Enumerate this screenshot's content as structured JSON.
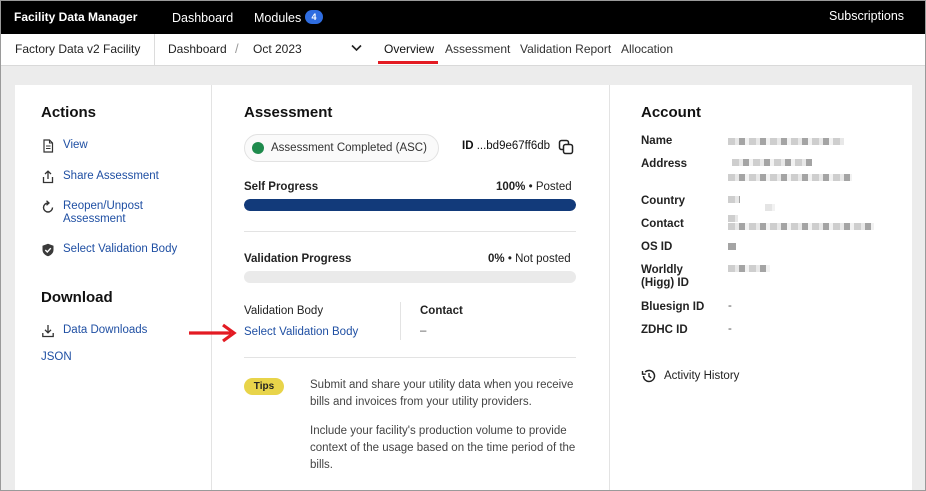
{
  "topbar": {
    "brand": "Facility Data Manager",
    "dashboard": "Dashboard",
    "modules": "Modules",
    "modules_count": "4",
    "subscriptions": "Subscriptions"
  },
  "subnav": {
    "facility": "Factory Data v2 Facility",
    "breadcrumb": "Dashboard",
    "separator": "/",
    "period": "Oct 2023",
    "tabs": [
      "Overview",
      "Assessment",
      "Validation Report",
      "Allocation"
    ],
    "active_tab": "Overview"
  },
  "actions": {
    "title": "Actions",
    "items": [
      {
        "label": "View",
        "icon": "document-icon"
      },
      {
        "label": "Share Assessment",
        "icon": "share-icon"
      },
      {
        "label": "Reopen/Unpost Assessment",
        "icon": "refresh-icon"
      },
      {
        "label": "Select Validation Body",
        "icon": "shield-check-icon"
      }
    ]
  },
  "download": {
    "title": "Download",
    "items": [
      {
        "label": "Data Downloads",
        "icon": "download-icon"
      },
      {
        "label": "JSON"
      }
    ]
  },
  "assessment": {
    "title": "Assessment",
    "status": "Assessment Completed (ASC)",
    "id_label": "ID",
    "id_value": "...bd9e67ff6db",
    "self_progress": {
      "label": "Self Progress",
      "percent": "100%",
      "sep": "•",
      "state": "Posted",
      "fraction": 1.0
    },
    "validation_progress": {
      "label": "Validation Progress",
      "percent": "0%",
      "sep": "•",
      "state": "Not posted",
      "fraction": 0.0
    },
    "validation_body_label": "Validation Body",
    "validation_body_link": "Select Validation Body",
    "contact_label": "Contact",
    "contact_value": "–",
    "tips_badge": "Tips",
    "tips": [
      "Submit and share your utility data when you receive bills and invoices from your utility providers.",
      "Include your facility's production volume to provide context of the usage based on the time period of the bills."
    ]
  },
  "account": {
    "title": "Account",
    "fields": [
      {
        "key": "Name"
      },
      {
        "key": "Address"
      },
      {
        "key": "Country"
      },
      {
        "key": "Contact"
      },
      {
        "key": "OS ID"
      },
      {
        "key": "Worldly (Higg) ID"
      },
      {
        "key": "Bluesign ID",
        "value": "-"
      },
      {
        "key": "ZDHC ID",
        "value": "-"
      }
    ],
    "activity_history": "Activity History"
  },
  "colors": {
    "topbar": "#000000",
    "accent_red": "#e31b23",
    "link_blue": "#1f4fa3",
    "progress_fill": "#123a7a",
    "status_green": "#1e8a4c",
    "tips_yellow": "#e8d44a",
    "badge_blue": "#2f6de0"
  }
}
